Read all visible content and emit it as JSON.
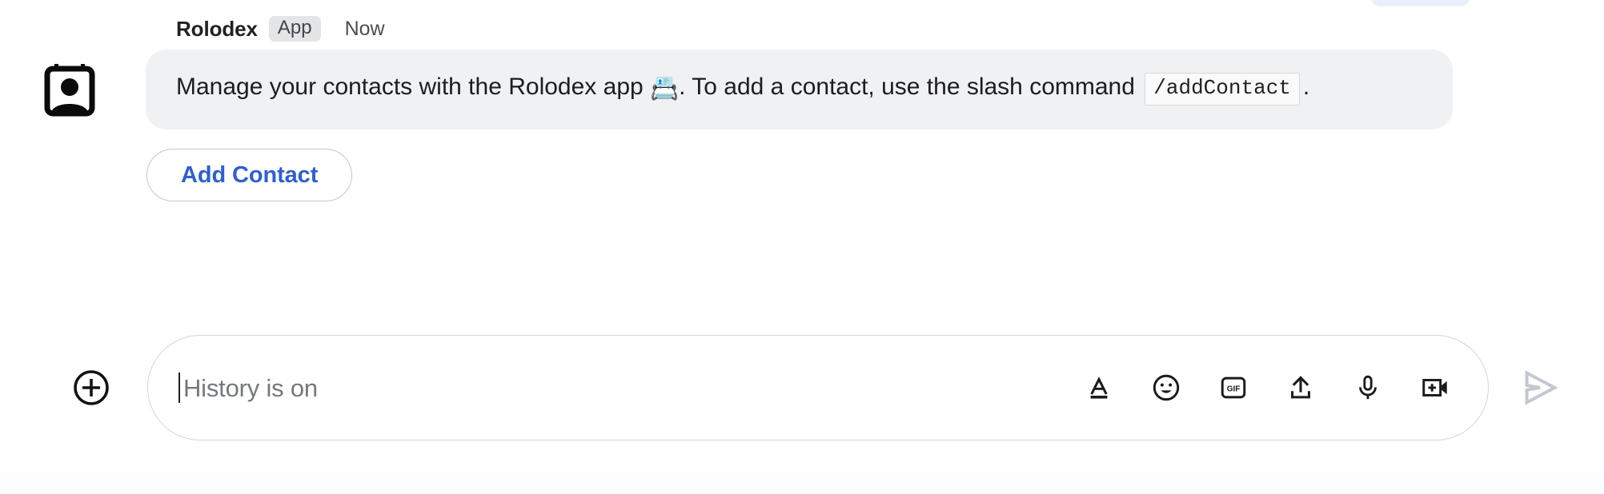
{
  "message": {
    "sender_name": "Rolodex",
    "badge_label": "App",
    "timestamp": "Now",
    "avatar_icon": "contact-card-icon",
    "body_before_emoji": "Manage your contacts with the Rolodex app ",
    "emoji": "📇",
    "body_after_emoji": ". To add a contact, use the slash command ",
    "slash_command": "/addContact",
    "body_end": ".",
    "bubble_bg": "#f0f1f2"
  },
  "actions": {
    "add_contact_label": "Add Contact",
    "accent_color": "#2f5fd0"
  },
  "composer": {
    "add_attachment_icon": "plus-circle-icon",
    "placeholder": "History is on",
    "value": "",
    "tools": [
      {
        "name": "format-text-icon",
        "label": "A"
      },
      {
        "name": "emoji-icon",
        "label": ""
      },
      {
        "name": "gif-icon",
        "label": "GIF"
      },
      {
        "name": "upload-icon",
        "label": ""
      },
      {
        "name": "microphone-icon",
        "label": ""
      },
      {
        "name": "add-video-icon",
        "label": ""
      }
    ],
    "send_icon": "send-arrow-icon",
    "send_enabled": false,
    "send_color": "#c3c8d0"
  }
}
